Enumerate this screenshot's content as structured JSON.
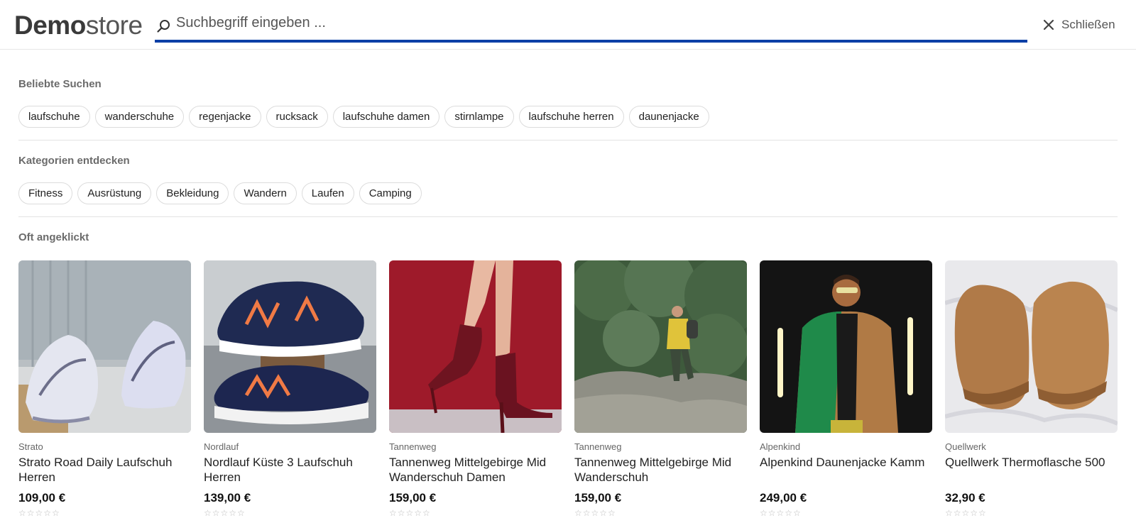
{
  "header": {
    "logo_bold": "Demo",
    "logo_light": "store",
    "search_placeholder": "Suchbegriff eingeben ...",
    "search_value": "",
    "close_label": "Schließen"
  },
  "popular": {
    "title": "Beliebte Suchen",
    "chips": [
      "laufschuhe",
      "wanderschuhe",
      "regenjacke",
      "rucksack",
      "laufschuhe damen",
      "stirnlampe",
      "laufschuhe herren",
      "daunenjacke"
    ]
  },
  "categories": {
    "title": "Kategorien entdecken",
    "chips": [
      "Fitness",
      "Ausrüstung",
      "Bekleidung",
      "Wandern",
      "Laufen",
      "Camping"
    ]
  },
  "frequent": {
    "title": "Oft angeklickt",
    "products": [
      {
        "brand": "Strato",
        "name": "Strato Road Daily Laufschuh Herren",
        "price": "109,00 €",
        "image": "white-running-shoes-photo"
      },
      {
        "brand": "Nordlauf",
        "name": "Nordlauf Küste 3 Laufschuh Herren",
        "price": "139,00 €",
        "image": "navy-sneakers-photo"
      },
      {
        "brand": "Tannenweg",
        "name": "Tannenweg Mittelgebirge Mid Wanderschuh Damen",
        "price": "159,00 €",
        "image": "burgundy-heel-boots-photo"
      },
      {
        "brand": "Tannenweg",
        "name": "Tannenweg Mittelgebirge Mid Wanderschuh",
        "price": "159,00 €",
        "image": "hiker-on-rocks-photo"
      },
      {
        "brand": "Alpenkind",
        "name": "Alpenkind Daunenjacke Kamm",
        "price": "249,00 €",
        "image": "man-in-jacket-neon-photo"
      },
      {
        "brand": "Quellwerk",
        "name": "Quellwerk Thermoflasche 500",
        "price": "32,90 €",
        "image": "suede-boots-photo"
      }
    ]
  },
  "colors": {
    "accent": "#0b3fa6",
    "section_title": "#6b6b6b",
    "chip_border": "#dcdcdc"
  }
}
